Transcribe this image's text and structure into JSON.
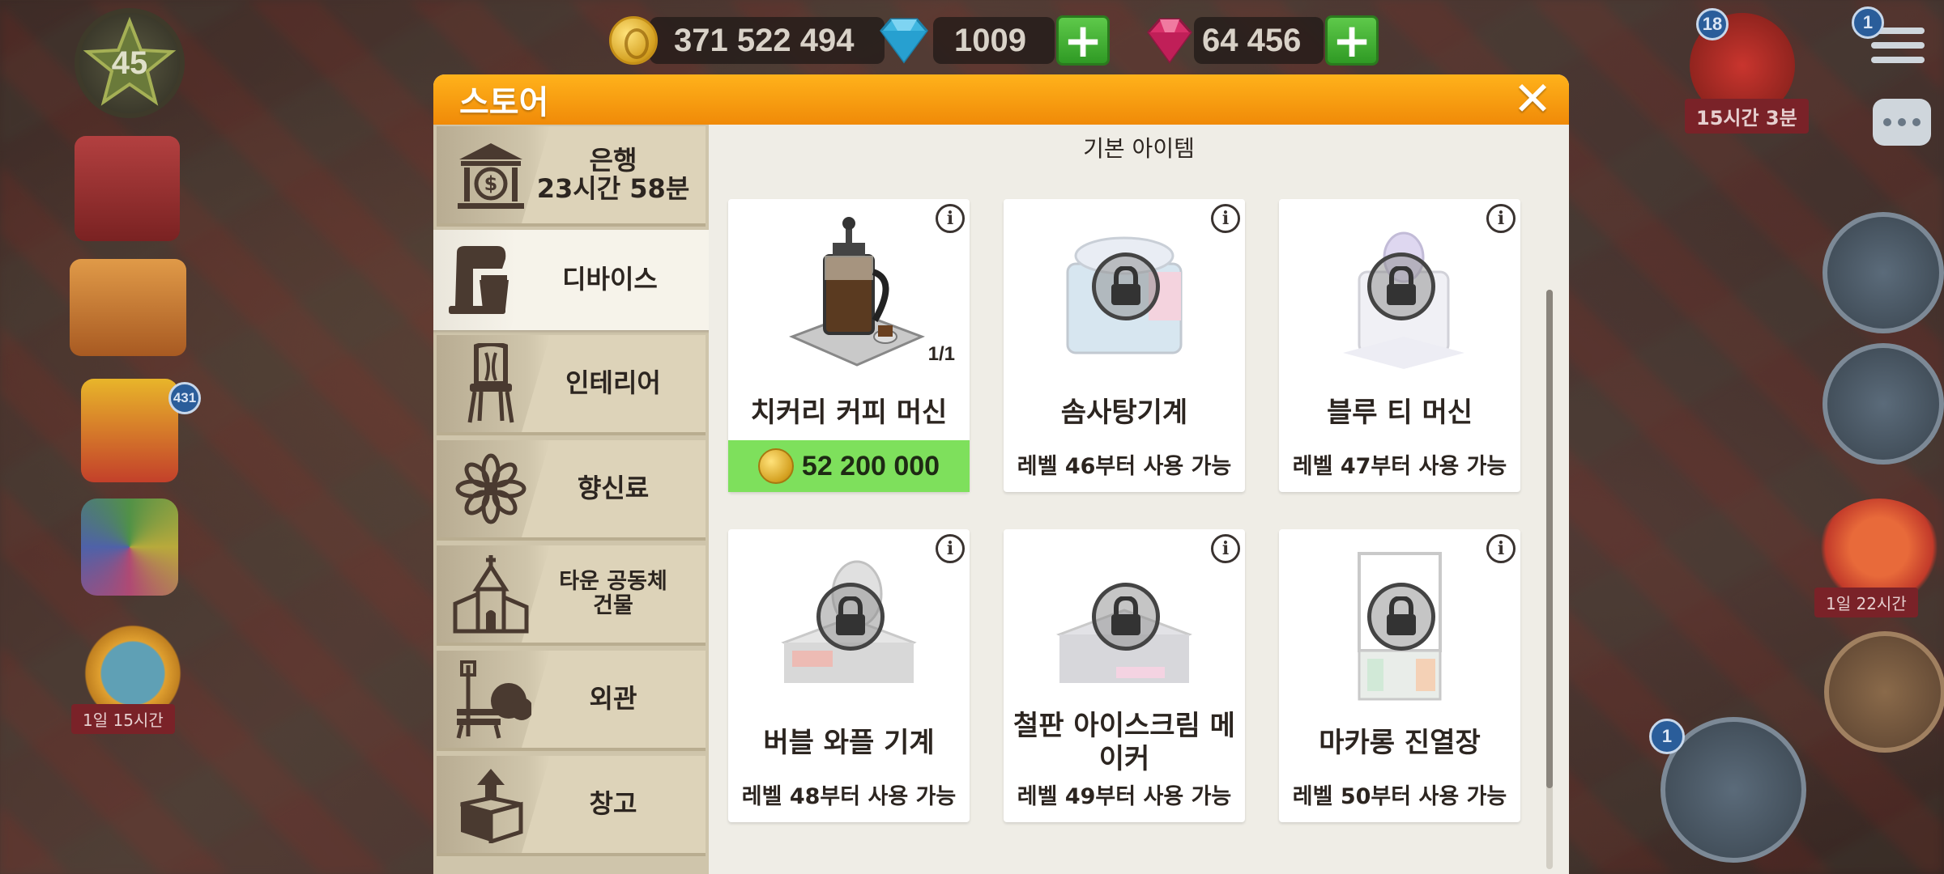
{
  "hud": {
    "level": "45",
    "coins": "371 522 494",
    "diamonds": "1009",
    "rubies": "64 456",
    "gift_timer": "15시간 3분",
    "gift_count": "18",
    "menu_badge": "1",
    "left_badge_gifts": "431",
    "left_ribbon_search": "1일 15시간",
    "right_ribbon_balloon": "1일 22시간",
    "register_badge": "1"
  },
  "modal": {
    "title": "스토어",
    "close_symbol": "✕",
    "section_title": "기본 아이템"
  },
  "tabs": [
    {
      "label": "은행",
      "sub": "23시간 58분",
      "icon": "bank-icon"
    },
    {
      "label": "디바이스",
      "icon": "mixer-icon"
    },
    {
      "label": "인테리어",
      "icon": "chair-icon"
    },
    {
      "label": "향신료",
      "icon": "anise-star-icon"
    },
    {
      "label": "타운 공동체",
      "sub": "건물",
      "icon": "church-icon"
    },
    {
      "label": "외관",
      "icon": "bench-icon"
    },
    {
      "label": "창고",
      "icon": "box-icon"
    }
  ],
  "items": [
    {
      "name": "치커리 커피 머신",
      "count": "1/1",
      "price": "52 200 000",
      "locked": false
    },
    {
      "name": "솜사탕기계",
      "requirement": "레벨 46부터 사용 가능",
      "locked": true
    },
    {
      "name": "블루 티 머신",
      "requirement": "레벨 47부터 사용 가능",
      "locked": true
    },
    {
      "name": "버블 와플 기계",
      "requirement": "레벨 48부터 사용 가능",
      "locked": true
    },
    {
      "name": "철판 아이스크림 메이커",
      "requirement": "레벨 49부터 사용 가능",
      "locked": true
    },
    {
      "name": "마카롱 진열장",
      "requirement": "레벨 50부터 사용 가능",
      "locked": true
    }
  ],
  "colors": {
    "header_orange": "#f59a0c",
    "price_green": "#7ee05c",
    "sidebar_tan": "#cfc5ab"
  }
}
